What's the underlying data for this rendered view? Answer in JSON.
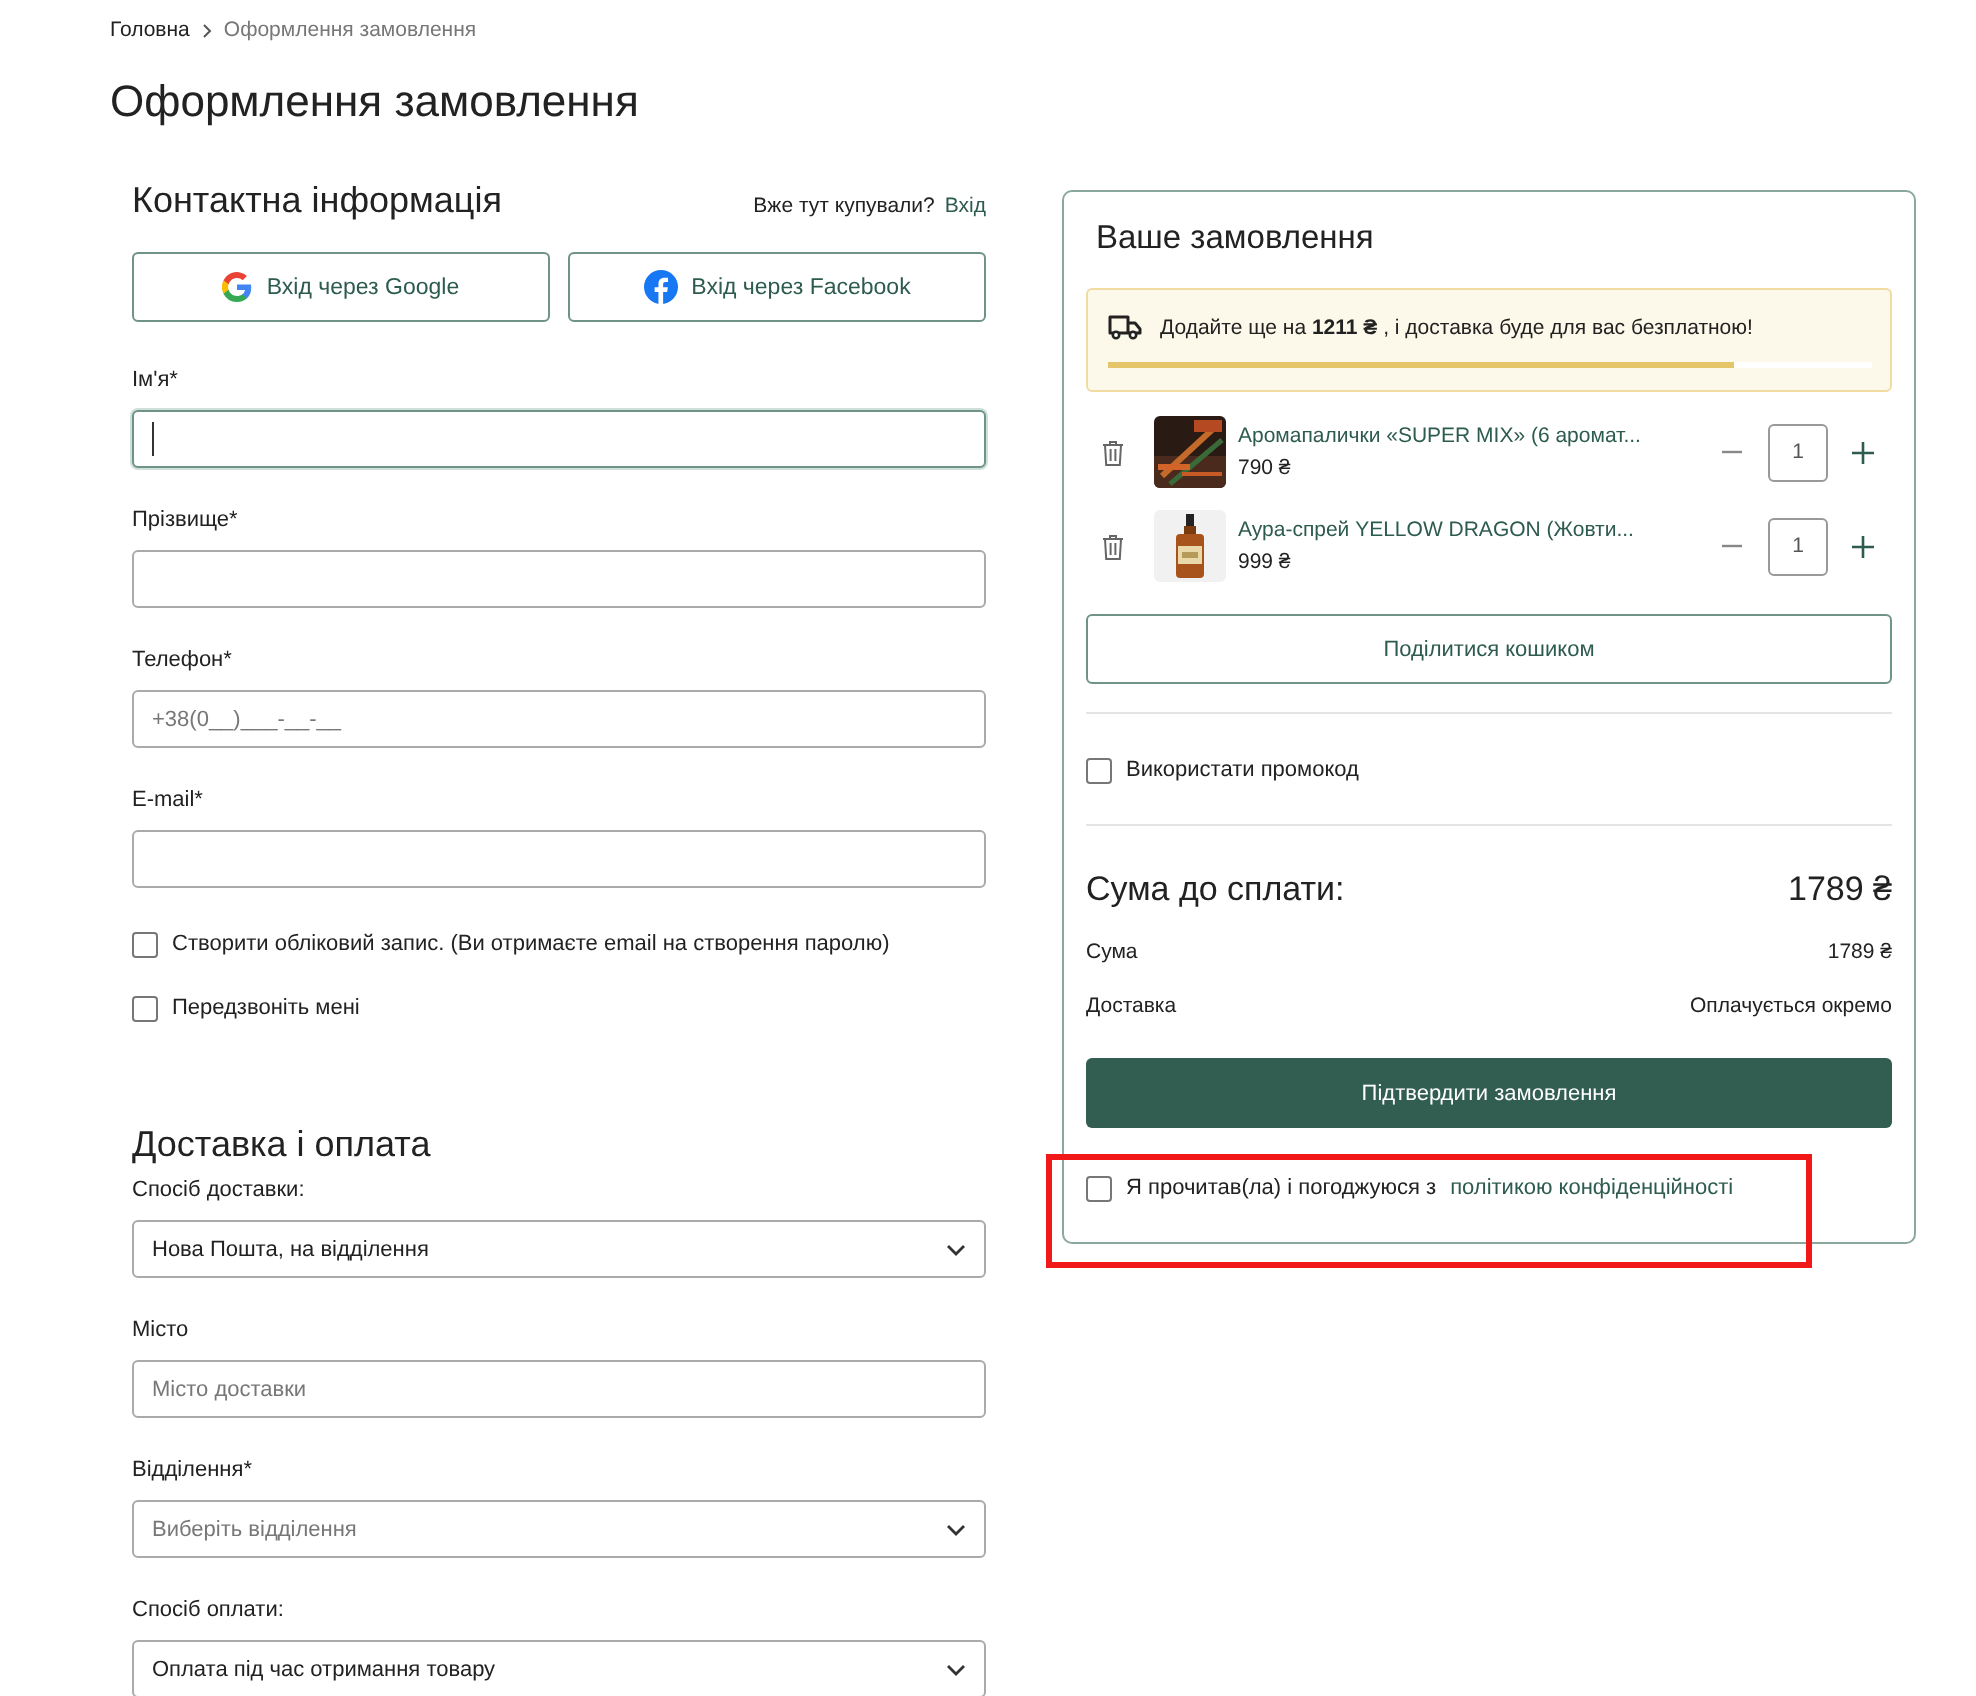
{
  "breadcrumbs": [
    {
      "label": "Головна",
      "current": false
    },
    {
      "label": "Оформлення замовлення",
      "current": true
    }
  ],
  "page_title": "Оформлення замовлення",
  "contact": {
    "title": "Контактна інформація",
    "login_prompt": "Вже тут купували?",
    "login_link": "Вхід",
    "social_buttons": [
      {
        "kind": "google",
        "label": "Вхід через Google"
      },
      {
        "kind": "facebook",
        "label": "Вхід через Facebook"
      }
    ],
    "fields": [
      {
        "label": "Ім'я*",
        "focused": true
      },
      {
        "label": "Прізвище*",
        "focused": false
      },
      {
        "label": "Телефон*",
        "placeholder": "+38(0__)___-__-__",
        "focused": false
      },
      {
        "label": "E-mail*",
        "focused": false
      }
    ],
    "checkboxes": [
      {
        "label": "Створити обліковий запис. (Ви отримаєте email на створення паролю)",
        "checked": false
      },
      {
        "label": "Передзвоніть мені",
        "checked": false
      }
    ]
  },
  "delivery": {
    "title": "Доставка і оплата",
    "fields": [
      {
        "kind": "select",
        "label": "Спосіб доставки:",
        "value": "Нова Пошта, на відділення"
      },
      {
        "kind": "input",
        "label": "Місто",
        "placeholder": "Місто доставки"
      },
      {
        "kind": "select",
        "label": "Відділення*",
        "placeholder": "Виберіть відділення"
      },
      {
        "kind": "select",
        "label": "Спосіб оплати:",
        "value": "Оплата під час отримання товару"
      }
    ]
  },
  "order": {
    "title": "Ваше замовлення",
    "free_shipping": {
      "text": "Додайте ще на **1211 ₴** , і доставка буде для вас безплатною!",
      "level": 0.82
    },
    "items": [
      {
        "name": "Аромапалички «SUPER MIX» (6 аромат...",
        "price": "790 ₴",
        "quantity": "1"
      },
      {
        "name": "Аура-спрей YELLOW DRAGON (Жовти...",
        "price": "999 ₴",
        "quantity": "1"
      }
    ],
    "share_button": "Поділитися кошиком",
    "promo": {
      "label": "Використати промокод",
      "checked": false
    },
    "total_label": "Сума до сплати:",
    "total_value": "1789 ₴",
    "summary": [
      {
        "label": "Сума",
        "value": "1789 ₴"
      },
      {
        "label": "Доставка",
        "value": "Оплачується окремо"
      }
    ],
    "confirm_button": "Підтвердити замовлення",
    "consent": {
      "text": "Я прочитав(ла) і погоджуюся з",
      "link": "політикою конфіденційності",
      "checked": false,
      "highlighted": true
    }
  }
}
